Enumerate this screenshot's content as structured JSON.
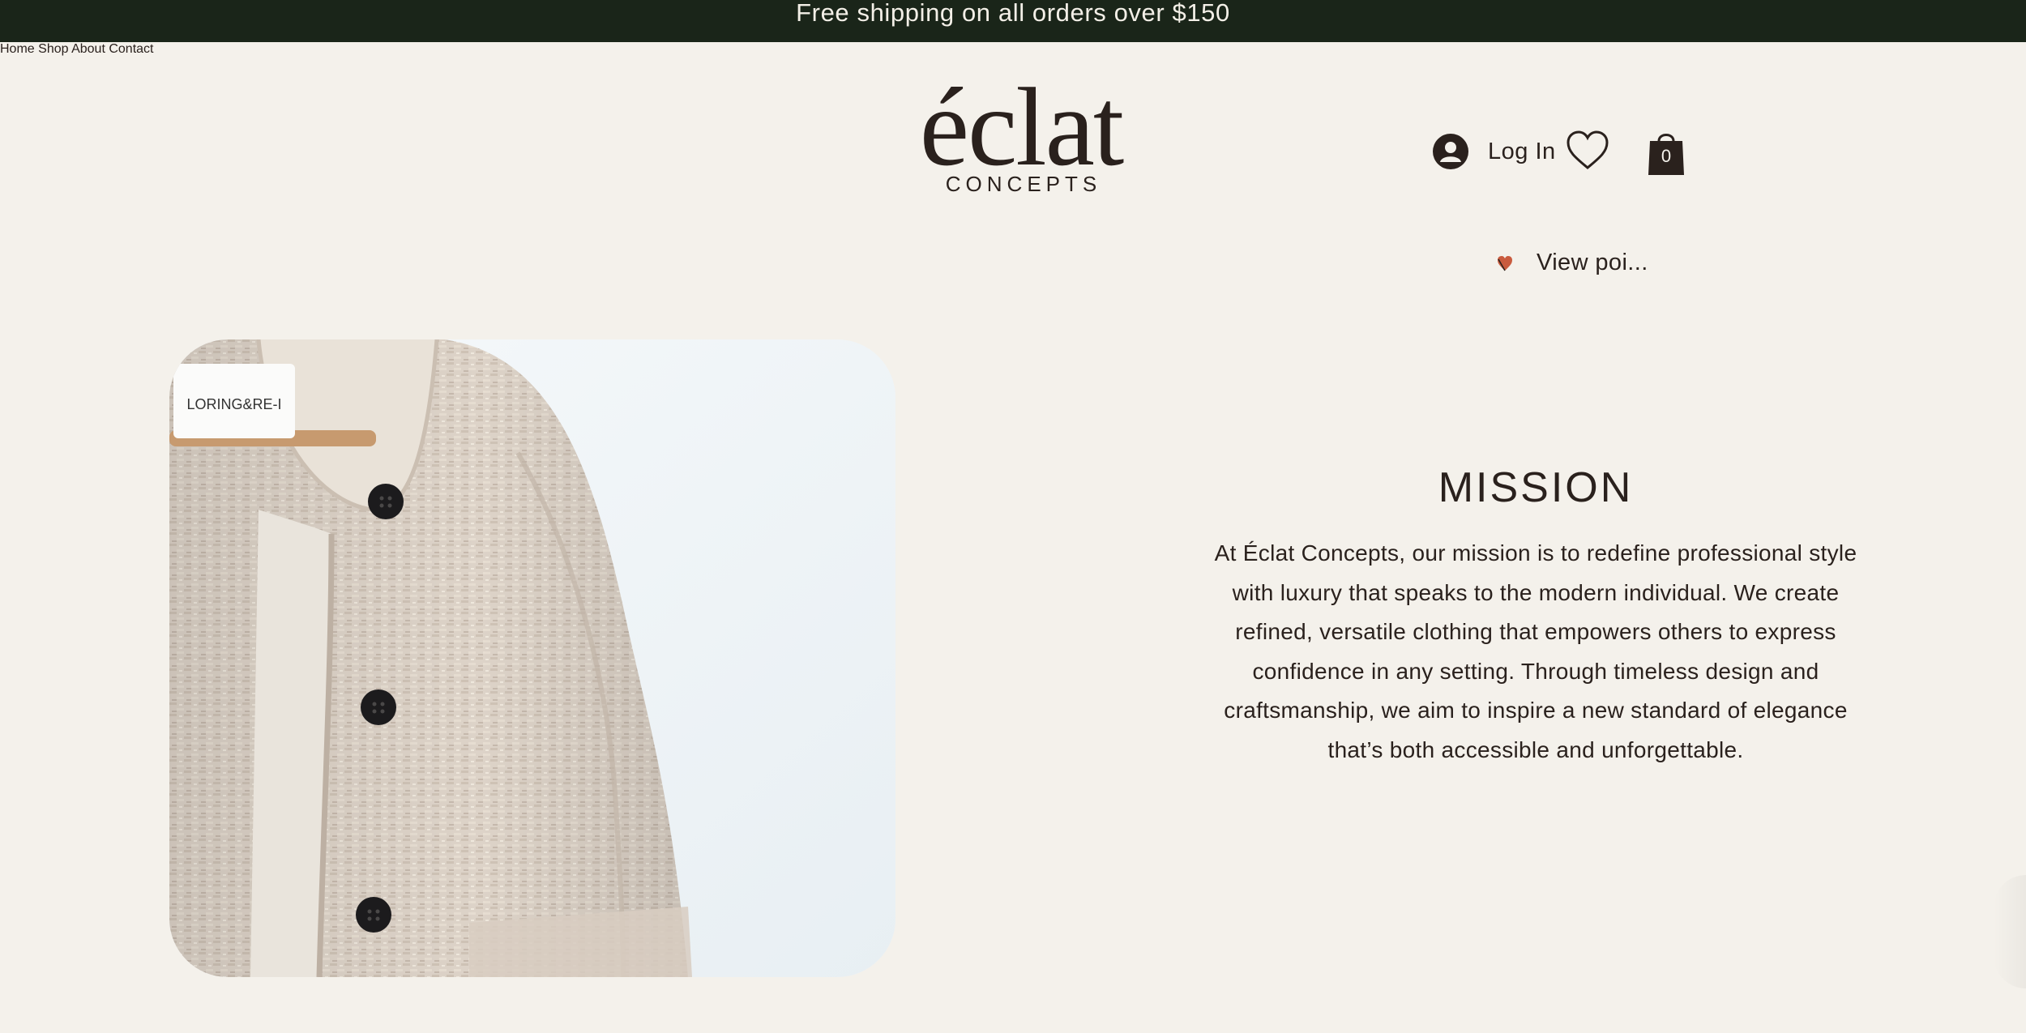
{
  "announcement": {
    "text": "Free shipping on all orders over $150"
  },
  "nav": {
    "items": [
      {
        "label": "Home"
      },
      {
        "label": "Shop"
      },
      {
        "label": "About"
      },
      {
        "label": "Contact"
      }
    ]
  },
  "logo": {
    "main": "éclat",
    "sub": "CONCEPTS"
  },
  "account": {
    "login_label": "Log In",
    "cart_count": "0",
    "points_label": "View poi..."
  },
  "hero": {
    "image_icon": "jacket-photo",
    "tag_text": "LORING&RE-I"
  },
  "mission": {
    "title": "MISSION",
    "text": "At Éclat Concepts, our mission is to redefine professional style with luxury that speaks to the modern individual. We create refined, versatile clothing that empowers others to express confidence in any setting. Through timeless design and craftsmanship, we aim to inspire a new standard of elegance that’s both accessible and unforgettable."
  },
  "colors": {
    "announcement_bg": "#1a2519",
    "page_bg": "#f4f1eb",
    "text": "#2a211d"
  }
}
